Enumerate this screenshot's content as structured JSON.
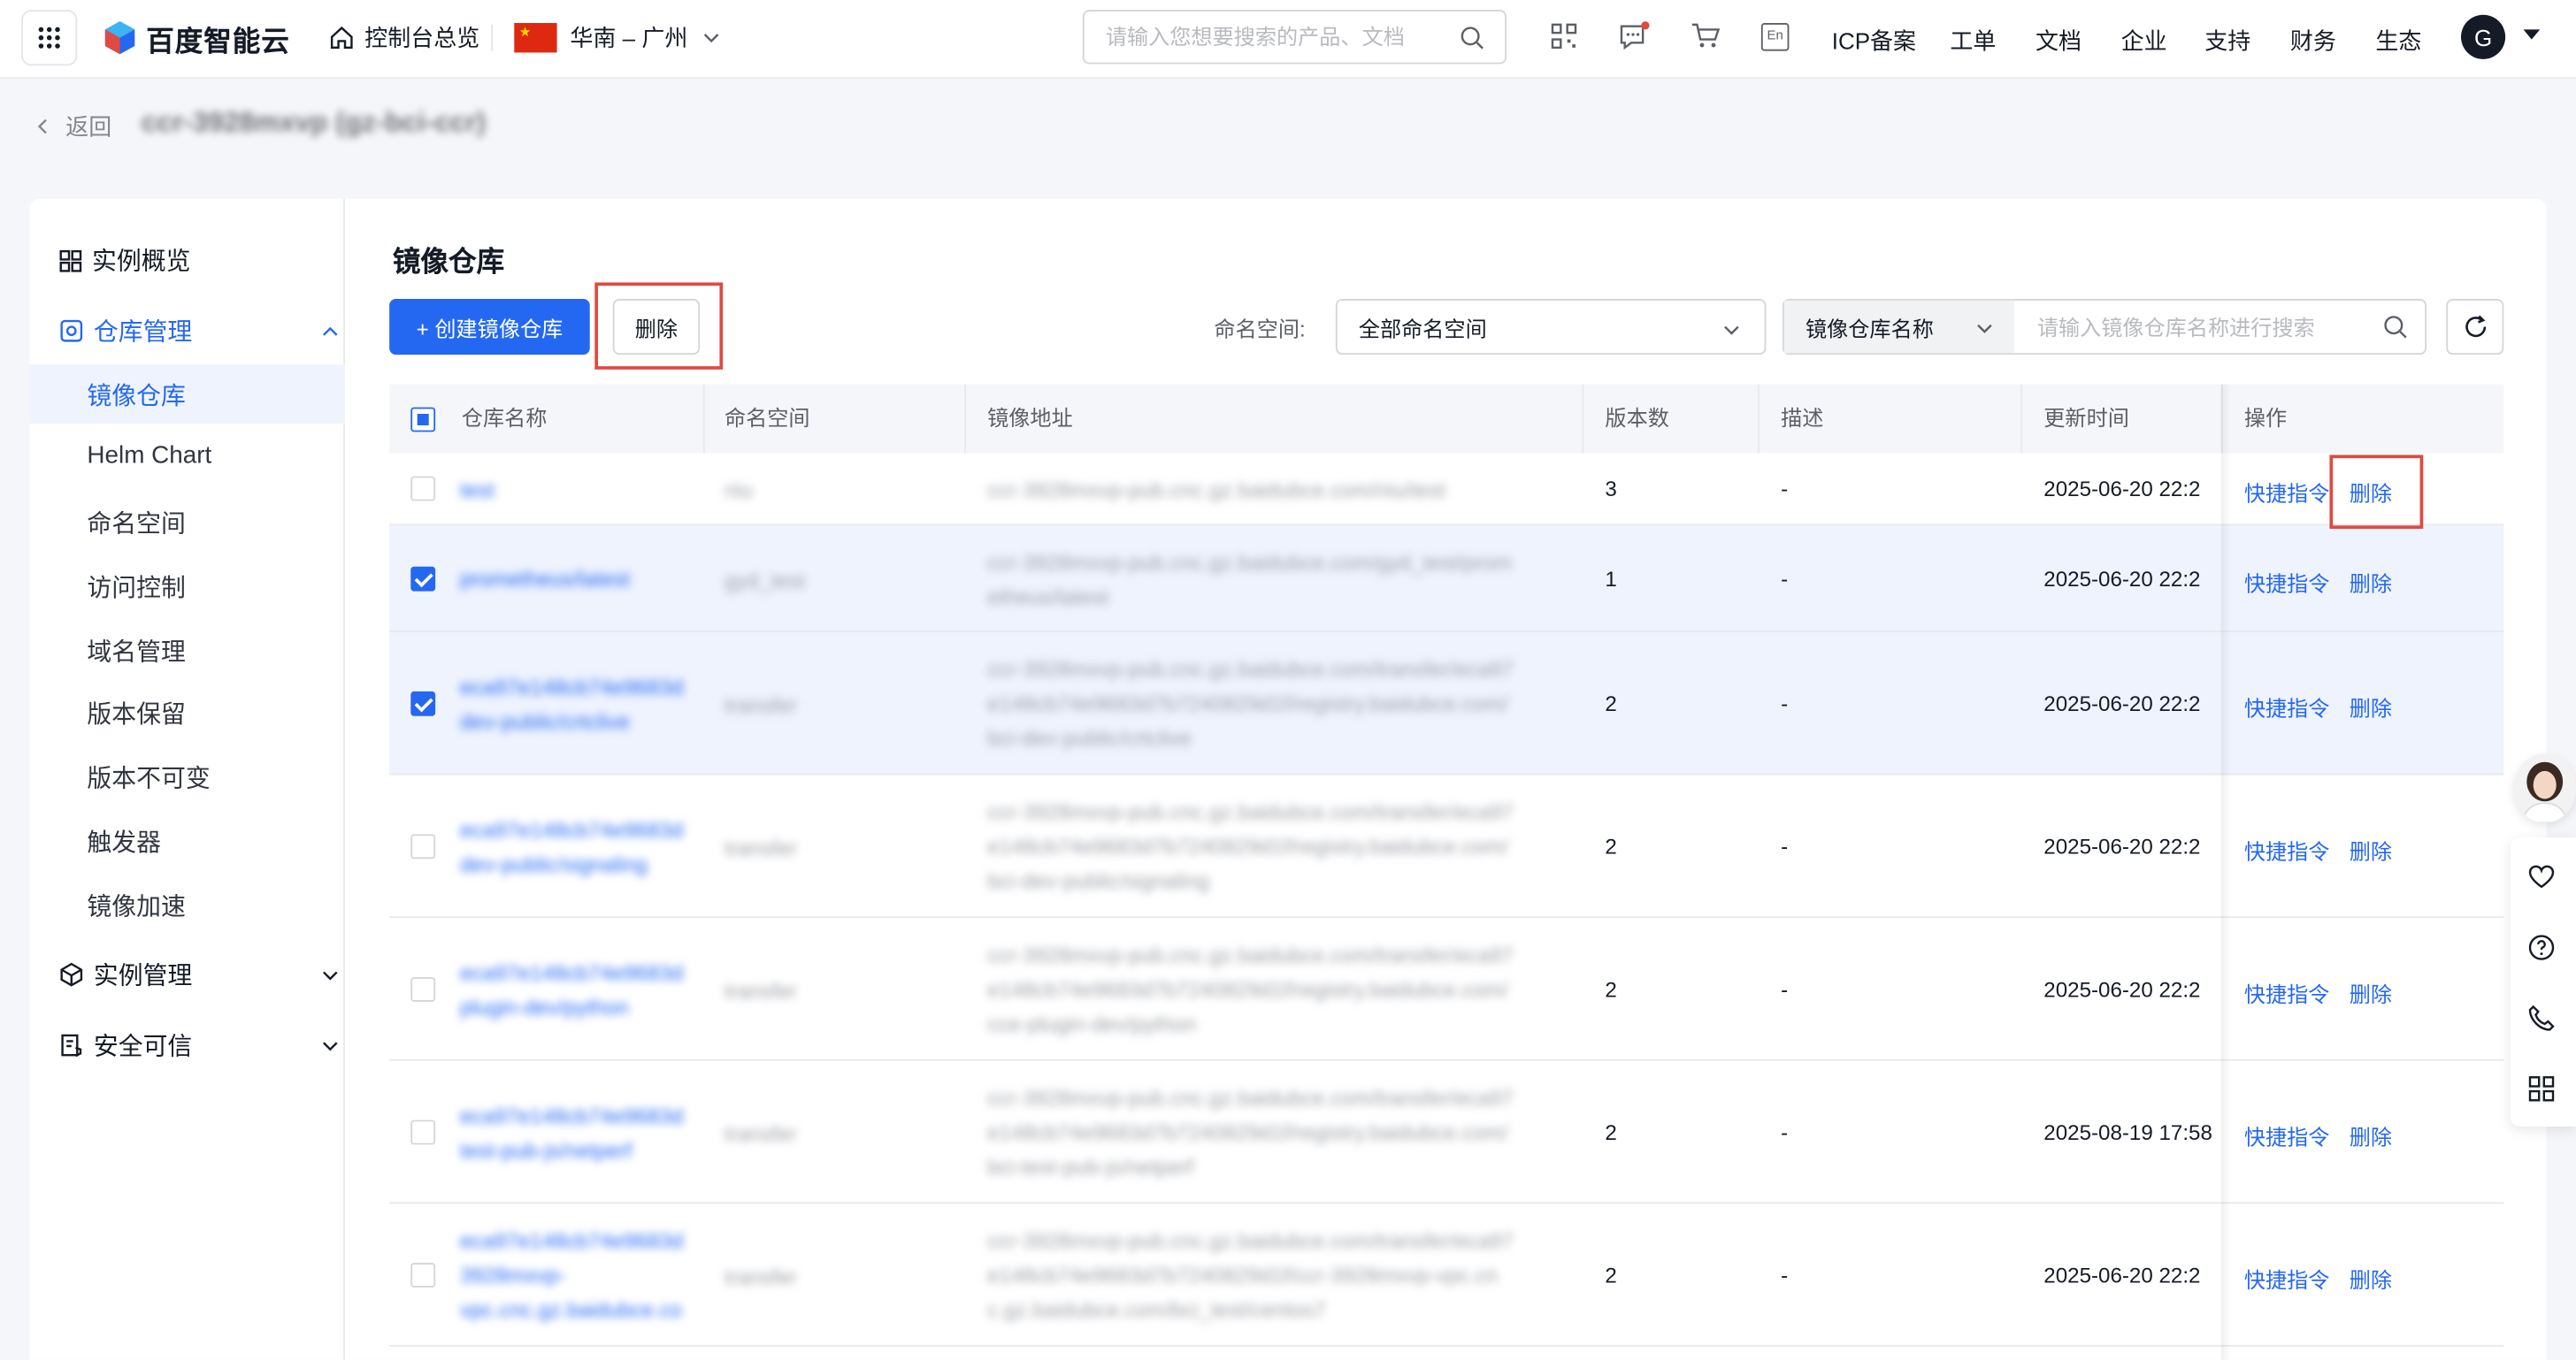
{
  "topbar": {
    "brand": "百度智能云",
    "home_label": "控制台总览",
    "region": "华南 – 广州",
    "search_placeholder": "请输入您想要搜索的产品、文档",
    "nav": [
      "ICP备案",
      "工单",
      "文档",
      "企业",
      "支持",
      "财务",
      "生态"
    ],
    "lang_badge": "En",
    "avatar_letter": "G"
  },
  "header": {
    "back_label": "返回",
    "instance_title": "ccr-3928mxvp (gz-bci-ccr)"
  },
  "sidebar": {
    "overview": "实例概览",
    "repo_group": "仓库管理",
    "repo_items": [
      "镜像仓库",
      "Helm Chart",
      "命名空间",
      "访问控制",
      "域名管理",
      "版本保留",
      "版本不可变",
      "触发器",
      "镜像加速"
    ],
    "instance_group": "实例管理",
    "security_group": "安全可信"
  },
  "main": {
    "title": "镜像仓库",
    "create_button": "+ 创建镜像仓库",
    "delete_button": "删除",
    "namespace_label": "命名空间:",
    "namespace_value": "全部命名空间",
    "search_type": "镜像仓库名称",
    "search_placeholder": "请输入镜像仓库名称进行搜索"
  },
  "table": {
    "columns": [
      "仓库名称",
      "命名空间",
      "镜像地址",
      "版本数",
      "描述",
      "更新时间",
      "操作"
    ],
    "op_quick": "快捷指令",
    "op_delete": "删除",
    "rows": [
      {
        "name": [
          "test"
        ],
        "namespace": "niu",
        "address": [
          "ccr-3928mxvp-pub.cnc.gz.baidubce.com/niu/test"
        ],
        "versions": "3",
        "desc": "-",
        "updated": "2025-06-20 22:2",
        "selected": false
      },
      {
        "name": [
          "prometheus/latest"
        ],
        "namespace": "gyd_test",
        "address": [
          "ccr-3928mxvp-pub.cnc.gz.baidubce.com/gyd_test/prom",
          "etheus/latest"
        ],
        "versions": "1",
        "desc": "-",
        "updated": "2025-06-20 22:2",
        "selected": true
      },
      {
        "name": [
          "eca97e148cb74e9683d",
          "dev-public/crtclive"
        ],
        "namespace": "transfer",
        "address": [
          "ccr-3928mxvp-pub.cnc.gz.baidubce.com/transfer/eca97",
          "e148cb74e9683d7b7240829d1f/registry.baidubce.com/",
          "bci-dev-public/crtclive"
        ],
        "versions": "2",
        "desc": "-",
        "updated": "2025-06-20 22:2",
        "selected": true
      },
      {
        "name": [
          "eca97e148cb74e9683d",
          "dev-public/signaling"
        ],
        "namespace": "transfer",
        "address": [
          "ccr-3928mxvp-pub.cnc.gz.baidubce.com/transfer/eca97",
          "e148cb74e9683d7b7240829d1f/registry.baidubce.com/",
          "bci-dev-public/signaling"
        ],
        "versions": "2",
        "desc": "-",
        "updated": "2025-06-20 22:2",
        "selected": false
      },
      {
        "name": [
          "eca97e148cb74e9683d",
          "plugin-dev/python"
        ],
        "namespace": "transfer",
        "address": [
          "ccr-3928mxvp-pub.cnc.gz.baidubce.com/transfer/eca97",
          "e148cb74e9683d7b7240829d1f/registry.baidubce.com/",
          "cce-plugin-dev/python"
        ],
        "versions": "2",
        "desc": "-",
        "updated": "2025-06-20 22:2",
        "selected": false
      },
      {
        "name": [
          "eca97e148cb74e9683d",
          "test-pub-js/netperf"
        ],
        "namespace": "transfer",
        "address": [
          "ccr-3928mxvp-pub.cnc.gz.baidubce.com/transfer/eca97",
          "e148cb74e9683d7b7240829d1f/registry.baidubce.com/",
          "bci-test-pub-js/netperf"
        ],
        "versions": "2",
        "desc": "-",
        "updated": "2025-08-19 17:58",
        "selected": false
      },
      {
        "name": [
          "eca97e148cb74e9683d",
          "3928mxvp-",
          "vpc.cnc.gz.baidubce.co"
        ],
        "namespace": "transfer",
        "address": [
          "ccr-3928mxvp-pub.cnc.gz.baidubce.com/transfer/eca97",
          "e148cb74e9683d7b7240829d1f/ccr-3928mxvp-vpc.cn",
          "c.gz.baidubce.com/bci_test/centos7"
        ],
        "versions": "2",
        "desc": "-",
        "updated": "2025-06-20 22:2",
        "selected": false
      }
    ]
  },
  "colors": {
    "accent": "#2468f2",
    "highlight_box": "#e04a3f",
    "selected_row": "#eef3fe"
  }
}
